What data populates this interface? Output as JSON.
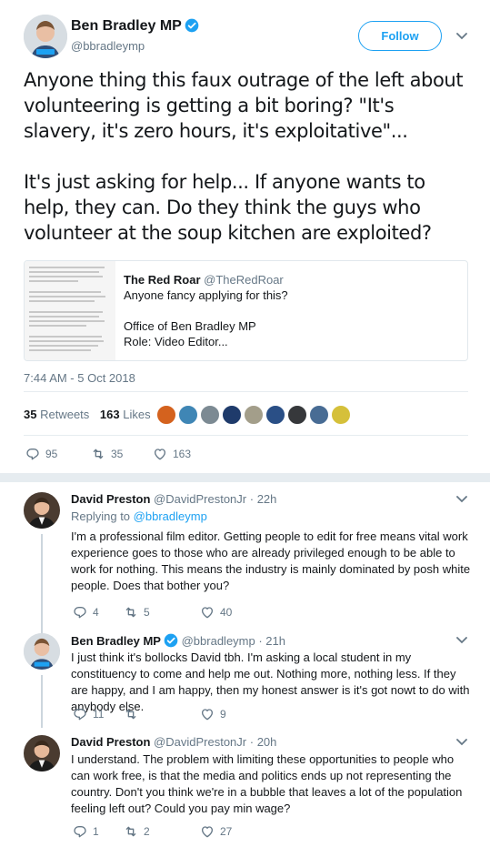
{
  "tweet": {
    "author_name": "Ben Bradley MP",
    "author_handle": "@bbradleymp",
    "follow_label": "Follow",
    "text": "Anyone thing this faux outrage of the left about volunteering is getting a bit boring? \"It's slavery, it's zero hours, it's exploitative\"...\n\nIt's just asking for help... If anyone wants to help, they can. Do they think the guys who volunteer at the soup kitchen are exploited?",
    "quote": {
      "name": "The Red Roar",
      "handle": "@TheRedRoar",
      "text": "Anyone fancy applying for this?\n\nOffice of Ben Bradley MP\nRole: Video Editor..."
    },
    "timestamp": "7:44 AM - 5 Oct 2018",
    "retweets_count": "35",
    "retweets_label": "Retweets",
    "likes_count": "163",
    "likes_label": "Likes",
    "actions": {
      "replies": "95",
      "retweets": "35",
      "likes": "163"
    }
  },
  "replies": [
    {
      "name": "David Preston",
      "handle": "@DavidPrestonJr",
      "time": "· 22h",
      "replying_prefix": "Replying to",
      "replying_to": "@bbradleymp",
      "text": "I'm a professional film editor. Getting people to edit for free means vital work experience goes to those who are already privileged enough to be able to work for nothing. This means the industry is mainly dominated by posh white people. Does that bother you?",
      "actions": {
        "replies": "4",
        "retweets": "5",
        "likes": "40"
      }
    },
    {
      "name": "Ben Bradley MP",
      "handle": "@bbradleymp",
      "time": "· 21h",
      "text": "I just think it's bollocks David tbh. I'm asking a local student in my constituency to come and help me out. Nothing more, nothing less. If they are happy, and I am happy, then my honest answer is it's got nowt to do with anybody else.",
      "actions": {
        "replies": "11",
        "retweets": "",
        "likes": "9"
      }
    },
    {
      "name": "David Preston",
      "handle": "@DavidPrestonJr",
      "time": "· 20h",
      "text": "I understand. The problem with limiting these opportunities to people who can work free, is that the media and politics ends up not representing the country. Don't you think we're in a bubble that leaves a lot of the population feeling left out? Could you pay min wage?",
      "actions": {
        "replies": "1",
        "retweets": "2",
        "likes": "27"
      }
    }
  ],
  "colors": {
    "accent": "#1da1f2",
    "muted": "#657786",
    "text": "#14171a",
    "border": "#e6ecf0"
  },
  "icons": [
    "verified-icon",
    "chevron-down-icon",
    "reply-icon",
    "retweet-icon",
    "heart-icon"
  ]
}
